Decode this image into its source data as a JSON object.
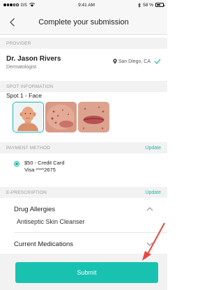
{
  "status_bar": {
    "carrier": "GS",
    "time": "9:41 AM",
    "battery": "58 %"
  },
  "nav": {
    "title": "Complete your submission"
  },
  "provider": {
    "section_label": "PROVIDER",
    "name": "Dr. Jason Rivers",
    "specialty": "Dermatologist",
    "location": "San Diego, CA"
  },
  "spot": {
    "section_label": "SPOT INFORMATION",
    "title": "Spot 1 - Face",
    "photos": [
      "face-illustration",
      "cheek-close-up",
      "lips-close-up"
    ]
  },
  "payment": {
    "section_label": "PAYMENT METHOD",
    "update_label": "Update",
    "line1": "$50  - Credit Card",
    "line2": "Visa ****2675"
  },
  "eprescription": {
    "section_label": "E-PRESCRIPTION",
    "update_label": "Update",
    "drug_allergies_label": "Drug Allergies",
    "drug_allergies_value": "Antiseptic Skin Cleanser",
    "current_medications_label": "Current Medications"
  },
  "submit_label": "Submit",
  "colors": {
    "accent": "#19c2b0",
    "annotation": "#e8463f"
  }
}
